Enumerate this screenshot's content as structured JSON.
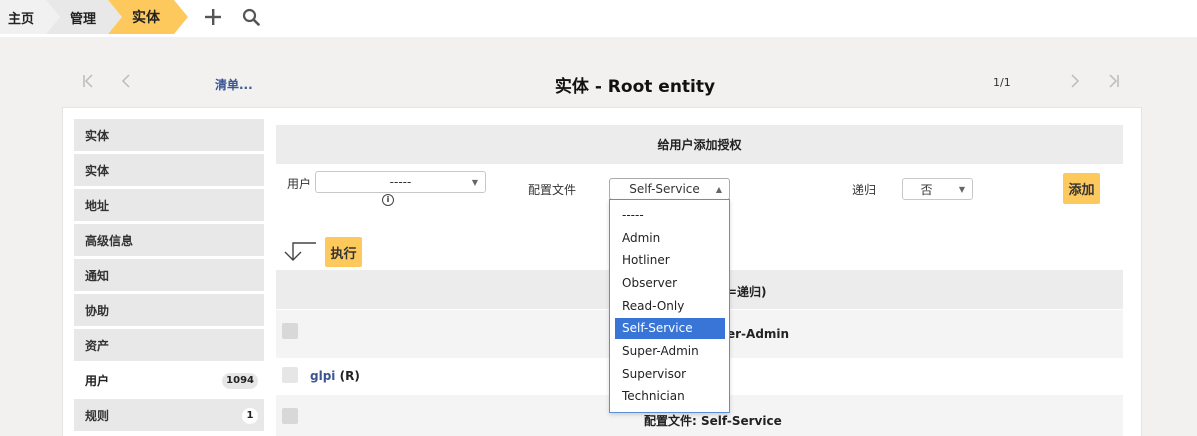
{
  "breadcrumb": {
    "home": "主页",
    "admin": "管理",
    "current": "实体"
  },
  "icons": {
    "add": "plus-icon",
    "search": "search-icon"
  },
  "nav": {
    "list_link": "清单...",
    "title": "实体 - Root entity",
    "pager": "1/1"
  },
  "sidebar": {
    "items": [
      {
        "label": "实体"
      },
      {
        "label": "实体"
      },
      {
        "label": "地址"
      },
      {
        "label": "高级信息"
      },
      {
        "label": "通知"
      },
      {
        "label": "协助"
      },
      {
        "label": "资产"
      },
      {
        "label": "用户",
        "badge": "1094"
      },
      {
        "label": "规则",
        "badge": "1"
      }
    ]
  },
  "form": {
    "section_title": "给用户添加授权",
    "user_label": "用户",
    "user_value": "-----",
    "profile_label": "配置文件",
    "profile_value": "Self-Service",
    "recursive_label": "递归",
    "recursive_value": "否",
    "add_button": "添加",
    "execute_button": "执行"
  },
  "table": {
    "header_text": "=递归)",
    "group1_text": "er-Admin",
    "user_name": "glpi",
    "user_flag": "(R)",
    "group2_text": "配置文件: Self-Service"
  },
  "dropdown": {
    "options": [
      "-----",
      "Admin",
      "Hotliner",
      "Observer",
      "Read-Only",
      "Self-Service",
      "Super-Admin",
      "Supervisor",
      "Technician"
    ],
    "selected": "Self-Service"
  },
  "colors": {
    "accent": "#fec95c",
    "link": "#3a5693",
    "selection": "#3875d7"
  }
}
